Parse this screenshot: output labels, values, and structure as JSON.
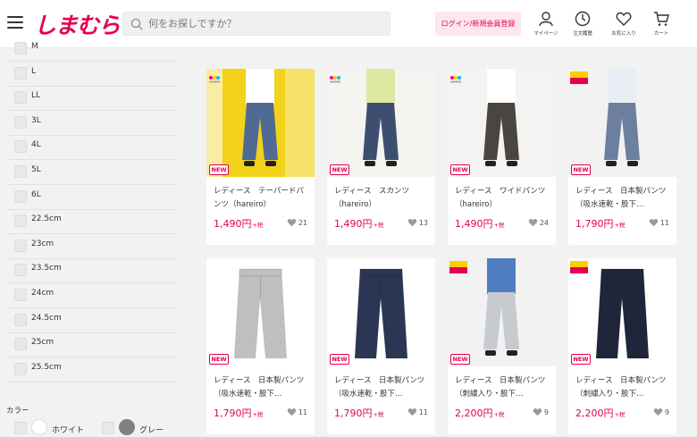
{
  "header": {
    "logo_text": "しまむら",
    "search_placeholder": "何をお探しですか？",
    "login_label": "ログイン/新規会員登録",
    "icons": [
      {
        "name": "mypage-icon",
        "label": "マイページ"
      },
      {
        "name": "order-history-icon",
        "label": "注文履歴"
      },
      {
        "name": "favorites-icon",
        "label": "お気に入り"
      },
      {
        "name": "cart-icon",
        "label": "カート"
      }
    ]
  },
  "sidebar": {
    "sizes": [
      "M",
      "L",
      "LL",
      "3L",
      "4L",
      "5L",
      "6L",
      "22.5cm",
      "23cm",
      "23.5cm",
      "24cm",
      "24.5cm",
      "25cm",
      "25.5cm"
    ],
    "color_heading": "カラー",
    "colors": [
      {
        "label": "ホワイト",
        "swatch": "#ffffff"
      },
      {
        "label": "グレー",
        "swatch": "#808080"
      }
    ]
  },
  "colors": {
    "brand": "#e5004f",
    "brand_light": "#fde6ee"
  },
  "products": [
    {
      "title": "レディース　テーパードパンツ（hareiro）",
      "price": "1,490円",
      "tax": "+税",
      "fav": "21",
      "badge": "NEW",
      "corner": "hareiro",
      "bg": "#f2d21a",
      "pants": "#4f6a93",
      "top": "#ffffff"
    },
    {
      "title": "レディース　スカンツ（hareiro）",
      "price": "1,490円",
      "tax": "+税",
      "fav": "13",
      "badge": "NEW",
      "corner": "hareiro",
      "bg": "#f4f4f0",
      "pants": "#3d4f70",
      "top": "#dfe8a2"
    },
    {
      "title": "レディース　ワイドパンツ（hareiro）",
      "price": "1,490円",
      "tax": "+税",
      "fav": "24",
      "badge": "NEW",
      "corner": "hareiro",
      "bg": "#f3f3f1",
      "pants": "#4a4540",
      "top": "#ffffff"
    },
    {
      "title": "レディース　日本製パンツ（吸水速乾・股下…",
      "price": "1,790円",
      "tax": "+税",
      "fav": "11",
      "badge": "NEW",
      "corner": "sale",
      "bg": "#f2f2f2",
      "pants": "#6d7f9e",
      "top": "#e8eef4"
    },
    {
      "title": "レディース　日本製パンツ（吸水速乾・股下…",
      "price": "1,790円",
      "tax": "+税",
      "fav": "11",
      "badge": "NEW",
      "corner": "",
      "bg": "#ffffff",
      "pants": "#bfbfbf",
      "top": ""
    },
    {
      "title": "レディース　日本製パンツ（吸水速乾・股下…",
      "price": "1,790円",
      "tax": "+税",
      "fav": "11",
      "badge": "NEW",
      "corner": "",
      "bg": "#ffffff",
      "pants": "#2b3654",
      "top": ""
    },
    {
      "title": "レディース　日本製パンツ（刺繍入り・股下…",
      "price": "2,200円",
      "tax": "+税",
      "fav": "9",
      "badge": "NEW",
      "corner": "sale",
      "bg": "#f2f2f2",
      "pants": "#c7cace",
      "top": "#4f7dbf"
    },
    {
      "title": "レディース　日本製パンツ（刺繍入り・股下…",
      "price": "2,200円",
      "tax": "+税",
      "fav": "9",
      "badge": "NEW",
      "corner": "sale",
      "bg": "#ffffff",
      "pants": "#1f2639",
      "top": ""
    }
  ]
}
